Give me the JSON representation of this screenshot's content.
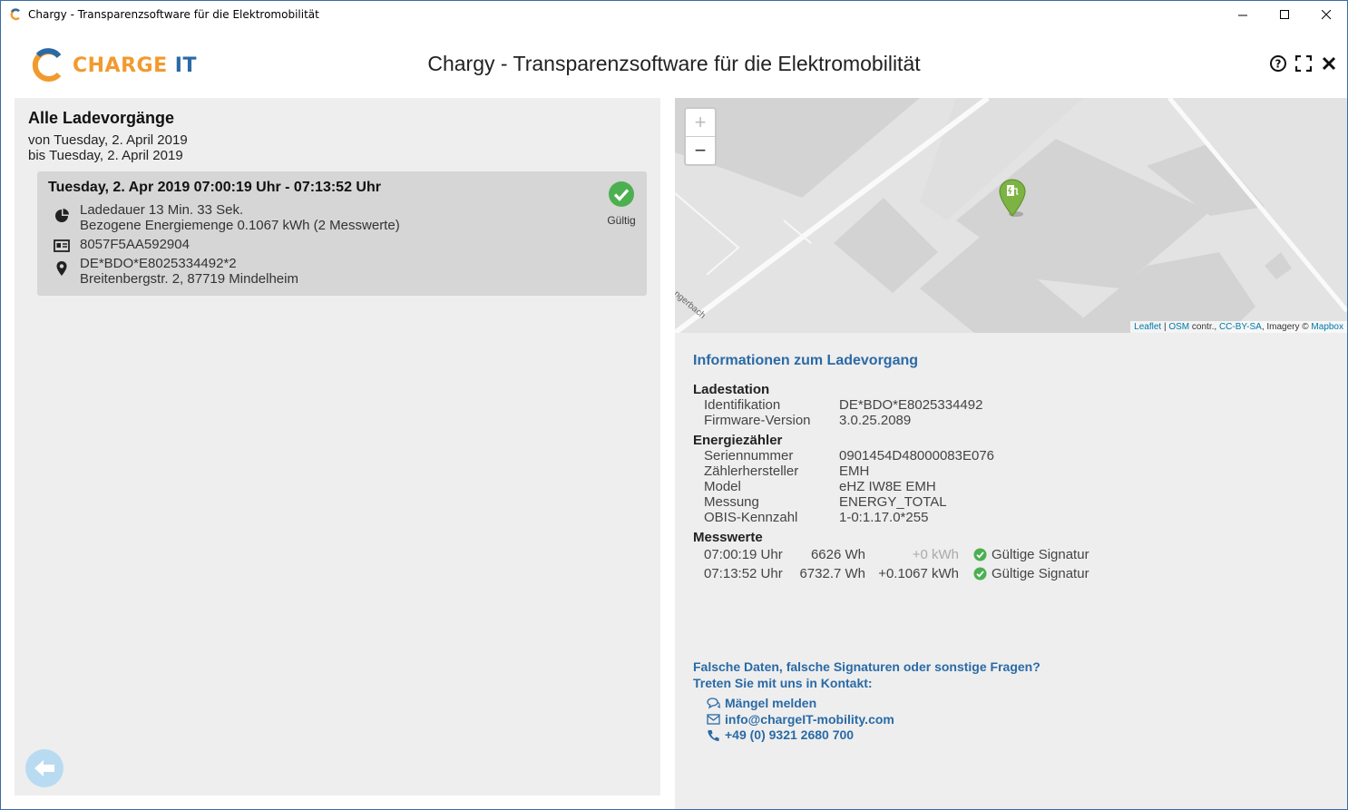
{
  "window": {
    "title": "Chargy - Transparenzsoftware für die Elektromobilität"
  },
  "header": {
    "logo_text_main": "CHARGE",
    "logo_text_accent": "IT",
    "app_title": "Chargy - Transparenzsoftware für die Elektromobilität"
  },
  "left": {
    "title": "Alle Ladevorgänge",
    "from": "von Tuesday, 2. April 2019",
    "to": "bis Tuesday, 2. April 2019",
    "session": {
      "title": "Tuesday, 2. Apr 2019 07:00:19 Uhr - 07:13:52 Uhr",
      "duration": "Ladedauer 13 Min. 33 Sek.",
      "energy": "Bezogene Energiemenge 0.1067 kWh (2 Messwerte)",
      "auth_id": "8057F5AA592904",
      "evse_id": "DE*BDO*E8025334492*2",
      "address": "Breitenbergstr. 2, 87719 Mindelheim",
      "status": "Gültig"
    }
  },
  "map": {
    "zoom_in": "+",
    "zoom_out": "−",
    "street_label": "ngerbach",
    "attribution": {
      "leaflet": "Leaflet",
      "sep1": " | ",
      "osm": "OSM",
      "contr": " contr., ",
      "license": "CC-BY-SA",
      "imagery": ", Imagery © ",
      "mapbox": "Mapbox"
    }
  },
  "info": {
    "title": "Informationen zum Ladevorgang",
    "station_heading": "Ladestation",
    "station": [
      {
        "k": "Identifikation",
        "v": "DE*BDO*E8025334492"
      },
      {
        "k": "Firmware-Version",
        "v": "3.0.25.2089"
      }
    ],
    "meter_heading": "Energiezähler",
    "meter": [
      {
        "k": "Seriennummer",
        "v": "0901454D48000083E076"
      },
      {
        "k": "Zählerhersteller",
        "v": "EMH"
      },
      {
        "k": "Model",
        "v": "eHZ IW8E EMH"
      },
      {
        "k": "Messung",
        "v": "ENERGY_TOTAL"
      },
      {
        "k": "OBIS-Kennzahl",
        "v": "1-0:1.17.0*255"
      }
    ],
    "values_heading": "Messwerte",
    "values": [
      {
        "time": "07:00:19 Uhr",
        "wh": "6626 Wh",
        "delta": "+0 kWh",
        "sig": "Gültige Signatur"
      },
      {
        "time": "07:13:52 Uhr",
        "wh": "6732.7 Wh",
        "delta": "+0.1067 kWh",
        "sig": "Gültige Signatur"
      }
    ]
  },
  "contact": {
    "line1": "Falsche Daten, falsche Signaturen oder sonstige Fragen?",
    "line2": "Treten Sie mit uns in Kontakt:",
    "report": "Mängel melden",
    "email": "info@chargeIT-mobility.com",
    "phone": "+49 (0) 9321 2680 700"
  },
  "colors": {
    "accent_blue": "#2a6aa6",
    "brand_orange": "#f29a2e",
    "valid_green": "#4caf50"
  }
}
